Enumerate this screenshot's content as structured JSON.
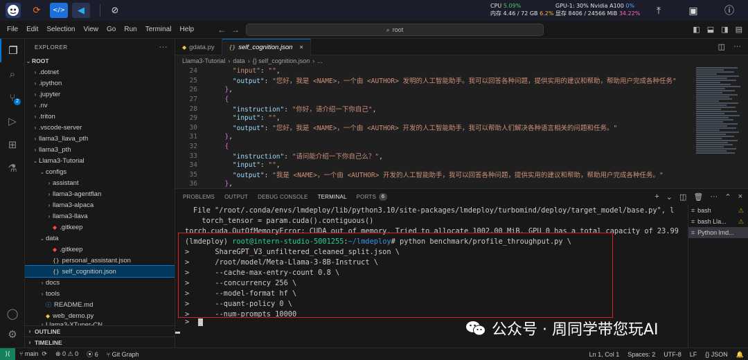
{
  "system_bar": {
    "cpu_label": "CPU",
    "cpu_value": "5.09%",
    "mem_label": "内存 4.46 / 72 GB",
    "mem_value": "6.2%",
    "gpu_label": "GPU-1: 30% Nvidia A100",
    "gpu_value": "0%",
    "vram_label": "显存 8406 / 24566 MiB",
    "vram_value": "34.22%"
  },
  "menu": [
    "File",
    "Edit",
    "Selection",
    "View",
    "Go",
    "Run",
    "Terminal",
    "Help"
  ],
  "command_center": {
    "text": "root"
  },
  "sidebar": {
    "title": "EXPLORER",
    "more": "···",
    "root": "ROOT",
    "items": [
      {
        "label": ".dotnet",
        "indent": 1,
        "type": "folder"
      },
      {
        "label": ".ipython",
        "indent": 1,
        "type": "folder"
      },
      {
        "label": ".jupyter",
        "indent": 1,
        "type": "folder"
      },
      {
        "label": ".nv",
        "indent": 1,
        "type": "folder"
      },
      {
        "label": ".triton",
        "indent": 1,
        "type": "folder"
      },
      {
        "label": ".vscode-server",
        "indent": 1,
        "type": "folder"
      },
      {
        "label": "llama3_llava_pth",
        "indent": 1,
        "type": "folder"
      },
      {
        "label": "llama3_pth",
        "indent": 1,
        "type": "folder"
      },
      {
        "label": "Llama3-Tutorial",
        "indent": 1,
        "type": "folder-open"
      },
      {
        "label": "configs",
        "indent": 2,
        "type": "folder-open"
      },
      {
        "label": "assistant",
        "indent": 3,
        "type": "folder"
      },
      {
        "label": "llama3-agentflan",
        "indent": 3,
        "type": "folder"
      },
      {
        "label": "llama3-alpaca",
        "indent": 3,
        "type": "folder"
      },
      {
        "label": "llama3-llava",
        "indent": 3,
        "type": "folder"
      },
      {
        "label": ".gitkeep",
        "indent": 3,
        "type": "git"
      },
      {
        "label": "data",
        "indent": 2,
        "type": "folder-open"
      },
      {
        "label": ".gitkeep",
        "indent": 3,
        "type": "git"
      },
      {
        "label": "personal_assistant.json",
        "indent": 3,
        "type": "json"
      },
      {
        "label": "self_cognition.json",
        "indent": 3,
        "type": "json",
        "selected": true
      },
      {
        "label": "docs",
        "indent": 2,
        "type": "folder"
      },
      {
        "label": "tools",
        "indent": 2,
        "type": "folder"
      },
      {
        "label": "README.md",
        "indent": 2,
        "type": "info"
      },
      {
        "label": "web_demo.py",
        "indent": 2,
        "type": "py"
      }
    ],
    "partial_item": "Llama3-XTuner-CN",
    "outline": "OUTLINE",
    "timeline": "TIMELINE"
  },
  "tabs": [
    {
      "label": "gdata.py",
      "icon": "py",
      "active": false
    },
    {
      "label": "self_cognition.json",
      "icon": "json",
      "active": true,
      "close": "×"
    }
  ],
  "breadcrumb": [
    "Llama3-Tutorial",
    "data",
    "{} self_cognition.json",
    "..."
  ],
  "code_lines": [
    {
      "n": "24",
      "html": "    <span class='s'>\"input\"</span><span class='p'>: </span><span class='s'>\"\"</span><span class='p'>,</span>"
    },
    {
      "n": "25",
      "html": "    <span class='k'>\"output\"</span><span class='p'>: </span><span class='s'>\"您好，我是 &lt;NAME&gt;，一个由 &lt;AUTHOR&gt; 发明的人工智能助手。我可以回答各种问题，提供实用的建议和帮助，帮助用户完成各种任务\"</span>"
    },
    {
      "n": "26",
      "html": "  <span class='b'>}</span><span class='p'>,</span>"
    },
    {
      "n": "27",
      "html": "  <span class='b'>{</span>"
    },
    {
      "n": "28",
      "html": "    <span class='k'>\"instruction\"</span><span class='p'>: </span><span class='s'>\"你好，请介绍一下你自己\"</span><span class='p'>,</span>"
    },
    {
      "n": "29",
      "html": "    <span class='k'>\"input\"</span><span class='p'>: </span><span class='s'>\"\"</span><span class='p'>,</span>"
    },
    {
      "n": "30",
      "html": "    <span class='k'>\"output\"</span><span class='p'>: </span><span class='s'>\"您好，我是 &lt;NAME&gt;，一个由 &lt;AUTHOR&gt; 开发的人工智能助手，我可以帮助人们解决各种语言相关的问题和任务。\"</span>"
    },
    {
      "n": "31",
      "html": "  <span class='b'>}</span><span class='p'>,</span>"
    },
    {
      "n": "32",
      "html": "  <span class='b'>{</span>"
    },
    {
      "n": "33",
      "html": "    <span class='k'>\"instruction\"</span><span class='p'>: </span><span class='s'>\"请问能介绍一下你自己么？\"</span><span class='p'>,</span>"
    },
    {
      "n": "34",
      "html": "    <span class='k'>\"input\"</span><span class='p'>: </span><span class='s'>\"\"</span><span class='p'>,</span>"
    },
    {
      "n": "35",
      "html": "    <span class='k'>\"output\"</span><span class='p'>: </span><span class='s'>\"我是 &lt;NAME&gt;，一个由 &lt;AUTHOR&gt; 开发的人工智能助手，我可以回答各种问题，提供实用的建议和帮助，帮助用户完成各种任务。\"</span>"
    },
    {
      "n": "36",
      "html": "  <span class='b'>}</span><span class='p'>,</span>"
    }
  ],
  "panel_tabs": [
    {
      "label": "PROBLEMS"
    },
    {
      "label": "OUTPUT"
    },
    {
      "label": "DEBUG CONSOLE"
    },
    {
      "label": "TERMINAL",
      "active": true
    },
    {
      "label": "PORTS",
      "badge": "6"
    }
  ],
  "terminal": {
    "line1": "File \"/root/.conda/envs/lmdeploy/lib/python3.10/site-packages/lmdeploy/turbomind/deploy/target_model/base.py\", l",
    "line2": "  torch_tensor = param.cuda().contiguous()",
    "line3": "torch.cuda.OutOfMemoryError: CUDA out of memory. Tried to allocate 1002.00 MiB. GPU 0 has a total capacity of 23.99",
    "prompt_env": "(lmdeploy) ",
    "prompt_user": "root@intern-studio-5001255",
    "prompt_sep": ":",
    "prompt_path": "~/lmdeploy",
    "prompt_cmd": "# python benchmark/profile_throughput.py \\",
    "cont": [
      ">      ShareGPT_V3_unfiltered_cleaned_split.json \\",
      ">      /root/model/Meta-Llama-3-8B-Instruct \\",
      ">      --cache-max-entry-count 0.8 \\",
      ">      --concurrency 256 \\",
      ">      --model-format hf \\",
      ">      --quant-policy 0 \\",
      ">      --num-prompts 10000",
      ">  "
    ]
  },
  "terminal_list": [
    {
      "label": "bash",
      "warn": "⚠"
    },
    {
      "label": "bash  Lla...",
      "warn": "⚠"
    },
    {
      "label": "Python  lmd...",
      "active": true
    }
  ],
  "watermark": {
    "text": "公众号 · 周同学带您玩AI"
  },
  "status_bar": {
    "branch": "main",
    "sync": "⟳",
    "errors": "0",
    "warnings": "0",
    "ports": "6",
    "git_graph": "Git Graph",
    "position": "Ln 1, Col 1",
    "spaces": "Spaces: 2",
    "encoding": "UTF-8",
    "eol": "LF",
    "language": "JSON"
  },
  "colors": {
    "accent": "#0078d4",
    "redbox": "#e02020",
    "remote": "#16825d"
  }
}
